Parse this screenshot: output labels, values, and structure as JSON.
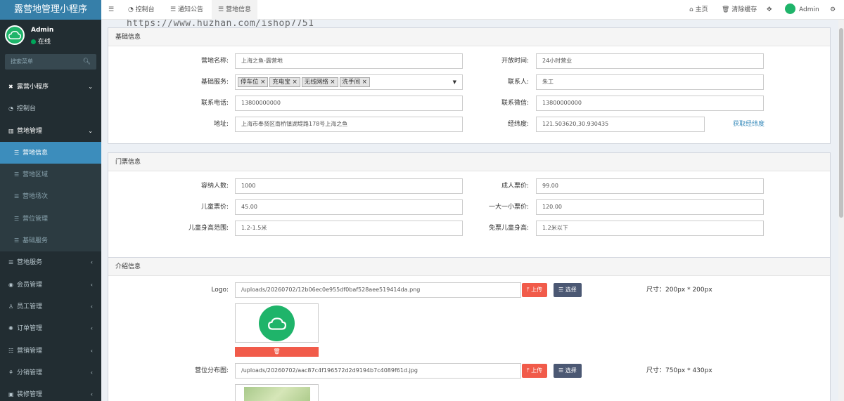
{
  "app": {
    "title": "露营地管理小程序"
  },
  "user": {
    "name": "Admin",
    "status": "在线"
  },
  "sidebar": {
    "search_placeholder": "搜索菜单",
    "items": [
      {
        "label": "露营小程序",
        "icon": "tools-icon"
      },
      {
        "label": "控制台",
        "icon": "dashboard-icon"
      },
      {
        "label": "营地管理",
        "icon": "book-icon"
      },
      {
        "label": "营地信息",
        "icon": "list-icon",
        "active": true
      },
      {
        "label": "营地区域",
        "icon": "list-icon"
      },
      {
        "label": "营地场次",
        "icon": "list-icon"
      },
      {
        "label": "营位管理",
        "icon": "list-icon"
      },
      {
        "label": "基础服务",
        "icon": "list-icon"
      },
      {
        "label": "营地服务",
        "icon": "list-icon"
      },
      {
        "label": "会员管理",
        "icon": "user-circle-icon"
      },
      {
        "label": "员工管理",
        "icon": "user-icon"
      },
      {
        "label": "订单管理",
        "icon": "gear-icon"
      },
      {
        "label": "营销管理",
        "icon": "megaphone-icon"
      },
      {
        "label": "分销管理",
        "icon": "sitemap-icon"
      },
      {
        "label": "装修管理",
        "icon": "paint-icon"
      }
    ]
  },
  "topbar": {
    "tabs": [
      {
        "label": "控制台"
      },
      {
        "label": "通知公告"
      },
      {
        "label": "营地信息",
        "active": true
      }
    ],
    "home": "主页",
    "clear_cache": "清除缓存",
    "user": "Admin"
  },
  "watermark": "https://www.huzhan.com/ishop7751",
  "basic": {
    "title": "基础信息",
    "name_label": "营地名称:",
    "name_value": "上海之鱼-露营地",
    "hours_label": "开放时间:",
    "hours_value": "24小时营业",
    "services_label": "基础服务:",
    "services": [
      "停车位",
      "充电宝",
      "无线网络",
      "洗手间"
    ],
    "contact_label": "联系人:",
    "contact_value": "朱工",
    "phone_label": "联系电话:",
    "phone_value": "13800000000",
    "wechat_label": "联系微信:",
    "wechat_value": "13800000000",
    "address_label": "地址:",
    "address_value": "上海市奉贤区南桥镇湖堤路178号上海之鱼",
    "coords_label": "经纬度:",
    "coords_value": "121.503620,30.930435",
    "coords_link": "获取经纬度"
  },
  "ticket": {
    "title": "门票信息",
    "capacity_label": "容纳人数:",
    "capacity_value": "1000",
    "adult_label": "成人票价:",
    "adult_value": "99.00",
    "child_label": "儿童票价:",
    "child_value": "45.00",
    "family_label": "一大一小票价:",
    "family_value": "120.00",
    "height_label": "儿童身高范围:",
    "height_value": "1.2-1.5米",
    "free_label": "免票儿童身高:",
    "free_value": "1.2米以下"
  },
  "intro": {
    "title": "介绍信息",
    "logo_label": "Logo:",
    "logo_path": "/uploads/20260702/12b06ec0e955df0baf528aee519414da.png",
    "upload_label": "上传",
    "choose_label": "选择",
    "logo_size": "尺寸：200px * 200px",
    "map_label": "营位分布图:",
    "map_path": "/uploads/20260702/aac87c4f196572d2d9194b7c4089f61d.jpg",
    "map_size": "尺寸：750px * 430px"
  },
  "colors": {
    "sidebar": "#222d32",
    "accent": "#3c8dbc",
    "brand_green": "#1fb46a",
    "danger": "#f15b4a"
  }
}
